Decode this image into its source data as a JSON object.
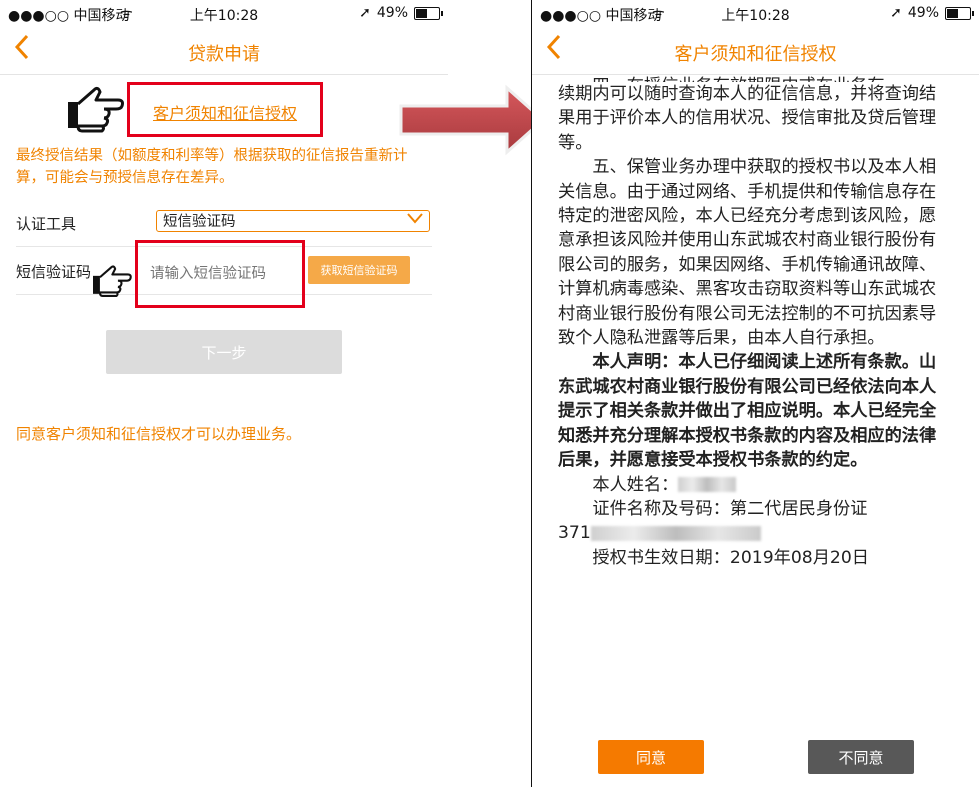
{
  "status_bar": {
    "carrier": "●●●○○ 中国移动",
    "time": "上午10:28",
    "battery": "49%",
    "battery_level": 0.49
  },
  "left_screen": {
    "title": "贷款申请",
    "auth_link": "客户须知和征信授权",
    "notice": "最终授信结果（如额度和利率等）根据获取的征信报告重新计算，可能会与预授信息存在差异。",
    "auth_tool": {
      "label": "认证工具",
      "value": "短信验证码"
    },
    "sms_code": {
      "label": "短信验证码",
      "placeholder": "请输入短信验证码",
      "button": "获取短信验证码"
    },
    "next_button": "下一步",
    "agree_tip": "同意客户须知和征信授权才可以办理业务。"
  },
  "right_screen": {
    "title": "客户须知和征信授权",
    "clipped_top": "四、在授信业务有效期限内或在业务存",
    "para4": "续期内可以随时查询本人的征信信息，并将查询结果用于评价本人的信用状况、授信审批及贷后管理等。",
    "para5": "五、保管业务办理中获取的授权书以及本人相关信息。由于通过网络、手机提供和传输信息存在特定的泄密风险，本人已经充分考虑到该风险，愿意承担该风险并使用山东武城农村商业银行股份有限公司的服务，如果因网络、手机传输通讯故障、计算机病毒感染、黑客攻击窃取资料等山东武城农村商业银行股份有限公司无法控制的不可抗因素导致个人隐私泄露等后果，由本人自行承担。",
    "declaration": "本人声明：本人已仔细阅读上述所有条款。山东武城农村商业银行股份有限公司已经依法向本人提示了相关条款并做出了相应说明。本人已经完全知悉并充分理解本授权书条款的内容及相应的法律后果，并愿意接受本授权书条款的约定。",
    "name_label": "本人姓名：",
    "id_label": "证件名称及号码：第二代居民身份证",
    "id_prefix": "371",
    "effective_date": "授权书生效日期：2019年08月20日",
    "agree_button": "同意",
    "disagree_button": "不同意"
  },
  "icons": {
    "back": "chevron-left-icon",
    "hand": "pointing-hand-icon",
    "arrow": "right-arrow-icon",
    "signal": "wifi-icon",
    "location": "location-arrow-icon",
    "battery": "battery-icon"
  },
  "colors": {
    "accent": "#f08300",
    "highlight_box": "#e3001b",
    "agree": "#f57a00",
    "disagree": "#585858",
    "disabled": "#dcdcdc",
    "arrow": "#c0464a"
  }
}
